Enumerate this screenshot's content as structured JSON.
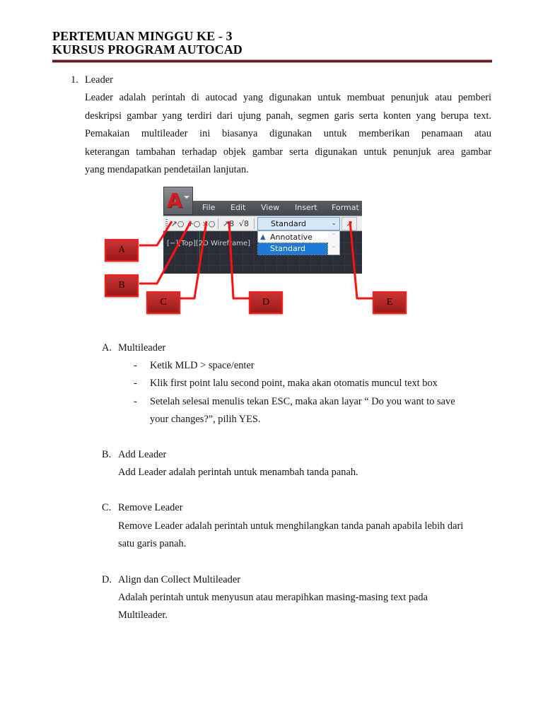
{
  "header": {
    "line1": "PERTEMUAN MINGGU KE - 3",
    "line2": "KURSUS PROGRAM AUTOCAD"
  },
  "section1": {
    "number": "1.",
    "title": "Leader",
    "paragraph_lines": [
      "Leader adalah perintah di autocad yang digunakan untuk membuat penunjuk atau pemberi",
      "deskripsi gambar yang terdiri dari ujung panah, segmen garis serta konten yang berupa text.",
      "Pemakaian multileader ini biasanya digunakan untuk memberikan penamaan atau",
      "keterangan tambahan terhadap objek gambar serta digunakan untuk penunjuk area gambar",
      "yang mendapatkan pendetailan lanjutan."
    ]
  },
  "figure": {
    "app_logo": "A",
    "menu": [
      "File",
      "Edit",
      "View",
      "Insert",
      "Format"
    ],
    "toolbar_icons": [
      "multileader-icon",
      "add-leader-icon",
      "remove-leader-icon",
      "align-multileader-icon",
      "collect-multileader-icon",
      "multileader-style-icon"
    ],
    "style_combo_value": "Standard",
    "dropdown_options": [
      "Annotative",
      "Standard"
    ],
    "dropdown_selected": "Standard",
    "viewport_label": "[−][Top][2D Wireframe]",
    "callouts": [
      "A",
      "B",
      "C",
      "D",
      "E"
    ],
    "callout_color": "#c62828"
  },
  "items": {
    "A": {
      "marker": "A.",
      "title": "Multileader",
      "bullets": [
        "Ketik MLD > space/enter",
        "Klik first point lalu second point, maka akan otomatis muncul text box",
        "Setelah selesai menulis tekan ESC, maka akan layar “ Do you want to save",
        "your changes?”, pilih YES."
      ]
    },
    "B": {
      "marker": "B.",
      "title": "Add Leader",
      "lines": [
        "Add Leader adalah perintah untuk menambah tanda panah."
      ]
    },
    "C": {
      "marker": "C.",
      "title": "Remove Leader",
      "lines": [
        "Remove Leader adalah perintah untuk menghilangkan tanda panah apabila lebih dari",
        "satu garis panah."
      ]
    },
    "D": {
      "marker": "D.",
      "title": "Align dan Collect Multileader",
      "lines": [
        "Adalah perintah untuk menyusun atau merapihkan masing-masing text pada",
        "Multileader."
      ]
    }
  },
  "bullet_symbol": "-"
}
